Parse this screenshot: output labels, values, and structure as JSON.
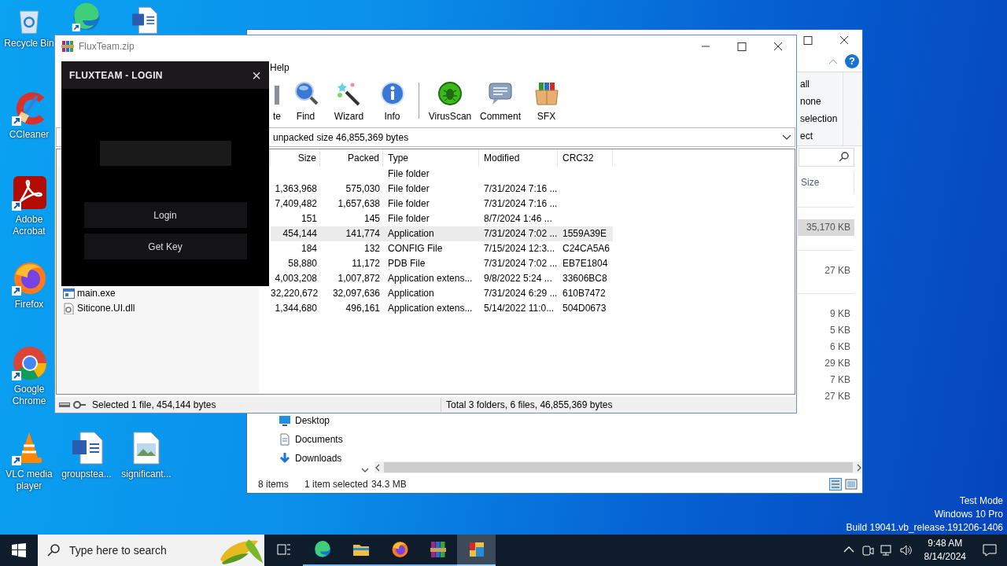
{
  "desktop": {
    "icons": [
      {
        "kind": "recycle_bin",
        "label": "Recycle Bin"
      },
      {
        "kind": "edge"
      },
      {
        "kind": "word_doc"
      },
      {
        "kind": "ccleaner",
        "label": "CCleaner"
      },
      {
        "kind": "acrobat",
        "label": "Adobe Acrobat"
      },
      {
        "kind": "firefox",
        "label": "Firefox"
      },
      {
        "kind": "chrome",
        "label": "Google Chrome"
      },
      {
        "kind": "vlc",
        "label": "VLC media player"
      },
      {
        "kind": "word_doc",
        "label": "groupstea..."
      },
      {
        "kind": "image_doc",
        "label": "significant..."
      }
    ],
    "system_info": [
      "Test Mode",
      "Windows 10 Pro",
      "Build 19041.vb_release.191206-1406"
    ]
  },
  "explorer": {
    "help": "?",
    "ribbon_items": [
      "all",
      "none",
      "selection",
      "ect"
    ],
    "column": "Size",
    "groups": [
      {
        "items": [
          {
            "size": "35,170 KB",
            "selected": true
          }
        ]
      },
      {
        "items": [
          {
            "size": "27 KB",
            "selected": false
          }
        ]
      },
      {
        "items": [
          {
            "size": "9 KB",
            "selected": false
          },
          {
            "size": "5 KB",
            "selected": false
          },
          {
            "size": "6 KB",
            "selected": false
          },
          {
            "size": "29 KB",
            "selected": false
          },
          {
            "size": "7 KB",
            "selected": false
          },
          {
            "size": "27 KB",
            "selected": false
          }
        ]
      }
    ],
    "nav_items": [
      {
        "kind": "desktop",
        "label": "Desktop"
      },
      {
        "kind": "documents",
        "label": "Documents"
      },
      {
        "kind": "downloads",
        "label": "Downloads"
      }
    ],
    "status": {
      "count": "8 items",
      "selection": "1 item selected",
      "size": "34.3 MB"
    }
  },
  "winrar": {
    "title": "FluxTeam.zip",
    "menu": [
      "Help"
    ],
    "tools": [
      {
        "kind": "delete",
        "label": "te"
      },
      {
        "kind": "find",
        "label": "Find"
      },
      {
        "kind": "wizard",
        "label": "Wizard"
      },
      {
        "kind": "info",
        "label": "Info"
      },
      {
        "kind": "separator"
      },
      {
        "kind": "virusscan",
        "label": "VirusScan"
      },
      {
        "kind": "comment",
        "label": "Comment"
      },
      {
        "kind": "sfx",
        "label": "SFX"
      }
    ],
    "path": "unpacked size 46,855,369 bytes",
    "columns": [
      "Size",
      "Packed",
      "Type",
      "Modified",
      "CRC32"
    ],
    "rows": [
      {
        "type": "File folder",
        "selected": false
      },
      {
        "size": "1,363,968",
        "packed": "575,030",
        "type": "File folder",
        "modified": "7/31/2024 7:16 ...",
        "selected": false
      },
      {
        "size": "7,409,482",
        "packed": "1,657,638",
        "type": "File folder",
        "modified": "7/31/2024 7:16 ...",
        "selected": false
      },
      {
        "size": "151",
        "packed": "145",
        "type": "File folder",
        "modified": "8/7/2024 1:46 ...",
        "selected": false
      },
      {
        "size": "454,144",
        "packed": "141,774",
        "type": "Application",
        "modified": "7/31/2024 7:02 ...",
        "crc": "1559A39E",
        "selected": true
      },
      {
        "size": "184",
        "packed": "132",
        "type": "CONFIG File",
        "modified": "7/15/2024 12:3...",
        "crc": "C24CA5A6",
        "selected": false
      },
      {
        "size": "58,880",
        "packed": "11,172",
        "type": "PDB File",
        "modified": "7/31/2024 7:02 ...",
        "crc": "EB7E1804",
        "selected": false
      },
      {
        "size": "4,003,208",
        "packed": "1,007,872",
        "type": "Application extens...",
        "modified": "9/8/2022 5:24 ...",
        "crc": "33606BC8",
        "selected": false
      },
      {
        "kind": "exe",
        "name": "main.exe",
        "size": "32,220,672",
        "packed": "32,097,636",
        "type": "Application",
        "modified": "7/31/2024 6:29 ...",
        "crc": "610B7472",
        "selected": false
      },
      {
        "kind": "dll",
        "name": "Siticone.UI.dll",
        "size": "1,344,680",
        "packed": "496,161",
        "type": "Application extens...",
        "modified": "5/14/2022 11:0...",
        "crc": "504D0673",
        "selected": false
      }
    ],
    "status": {
      "left": "Selected 1 file, 454,144 bytes",
      "right": "Total 3 folders, 6 files, 46,855,369 bytes"
    }
  },
  "login": {
    "title": "FLUXTEAM - LOGIN",
    "close": "×",
    "buttons": [
      "Login",
      "Get Key"
    ]
  },
  "taskbar": {
    "search_placeholder": "Type here to search",
    "apps": [
      {
        "kind": "edge",
        "running": true,
        "selected": false
      },
      {
        "kind": "explorer",
        "running": true,
        "selected": false
      },
      {
        "kind": "firefox",
        "running": true,
        "selected": false
      },
      {
        "kind": "winrar",
        "running": true,
        "selected": false
      },
      {
        "kind": "app",
        "running": true,
        "selected": true
      }
    ],
    "time": "9:48 AM",
    "date": "8/14/2024"
  }
}
